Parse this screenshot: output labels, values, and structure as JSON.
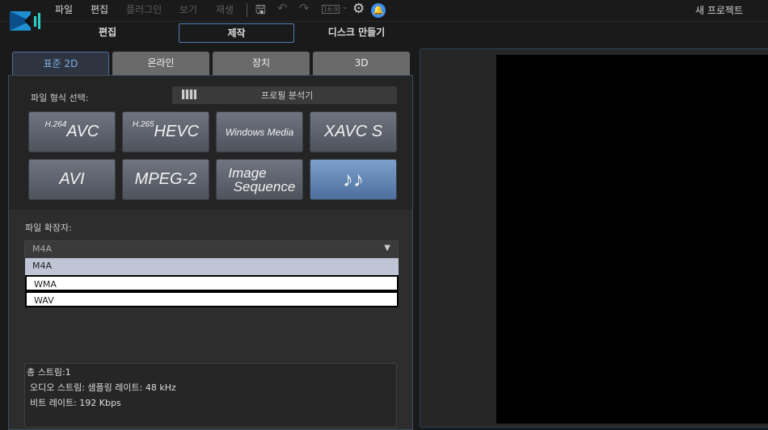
{
  "menu": {
    "items": [
      "파일",
      "편집",
      "플러그인",
      "보기",
      "재생"
    ],
    "aspect": "16:9",
    "project_title": "새 프로젝트"
  },
  "modes": {
    "edit": "편집",
    "produce": "제작",
    "disc": "디스크 만들기"
  },
  "format_tabs": [
    "표준 2D",
    "온라인",
    "장치",
    "3D"
  ],
  "format_select_label": "파일 형식 선택:",
  "profile_analyzer": "프로필 분석기",
  "formats": {
    "avc_sup": "H.264",
    "avc": "AVC",
    "hevc_sup": "H.265",
    "hevc": "HEVC",
    "wmv": "Windows Media",
    "xavc": "XAVC S",
    "avi": "AVI",
    "mpeg2": "MPEG-2",
    "img1": "Image",
    "img2": "Sequence",
    "audio": "♪♪"
  },
  "extension_label": "파일 확장자:",
  "extension": {
    "selected": "M4A",
    "options": [
      "M4A",
      "WMA",
      "WAV"
    ]
  },
  "info": [
    "총 스트림:1",
    "오디오 스트림: 샘플링 레이트: 48 kHz",
    "비트 레이트: 192 Kbps"
  ]
}
